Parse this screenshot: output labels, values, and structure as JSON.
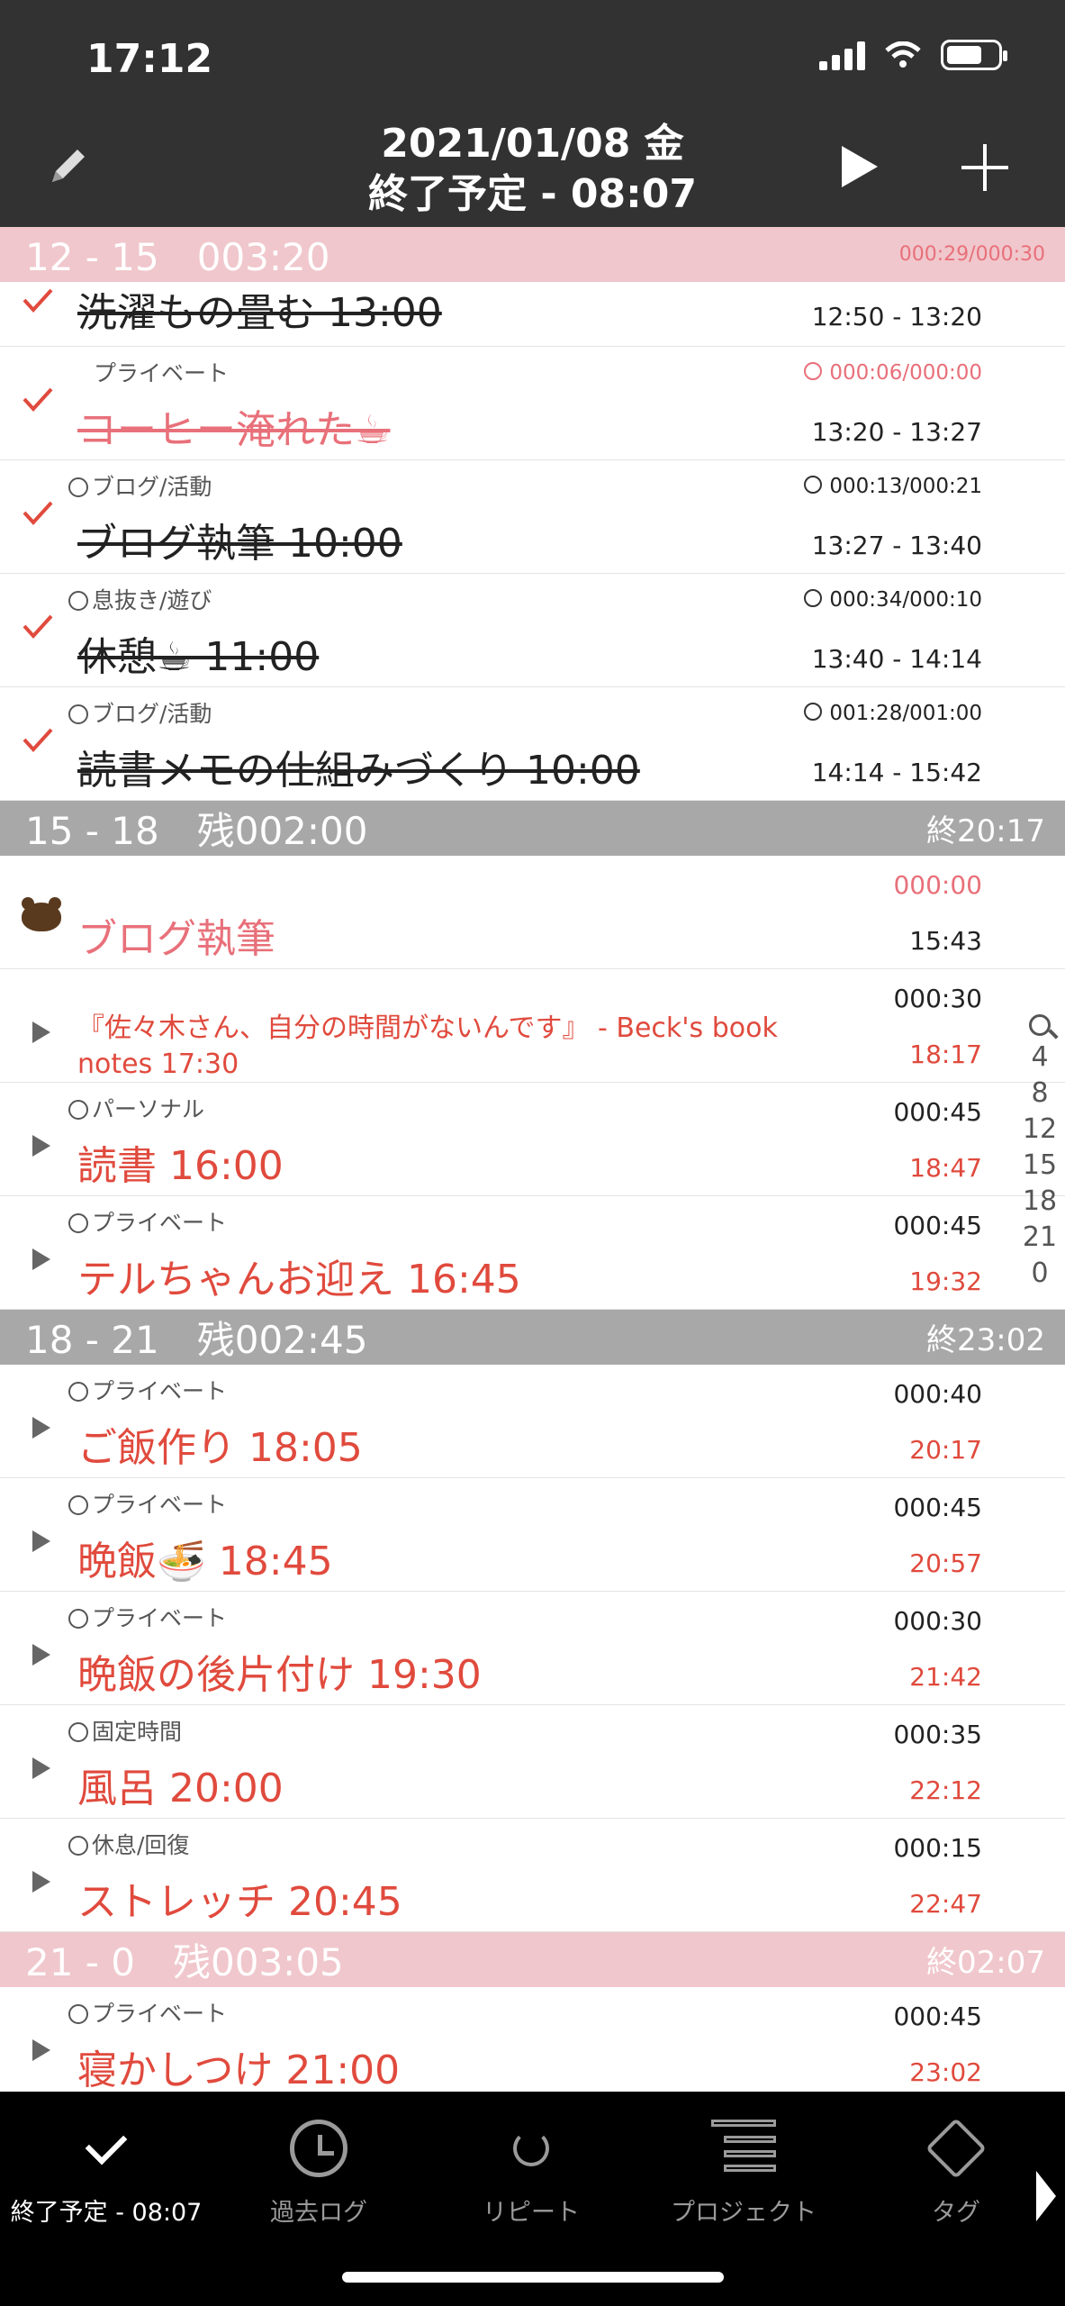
{
  "status_bar": {
    "time": "17:12"
  },
  "nav": {
    "date": "2021/01/08 金",
    "subtitle": "終了予定 - 08:07"
  },
  "sections": {
    "s12": {
      "label": "12 - 15　003:20",
      "right": "000:29/000:30"
    },
    "s15": {
      "label": "15 - 18　残002:00",
      "right": "終20:17"
    },
    "s18": {
      "label": "18 - 21　残002:45",
      "right": "終23:02"
    },
    "s21": {
      "label": "21 - 0　残003:05",
      "right": "終02:07"
    }
  },
  "tasks": [
    {
      "category": "",
      "title": "洗濯もの畳む 13:00",
      "duration": "",
      "time": "12:50 - 13:20"
    },
    {
      "category": "プライベート",
      "title": "コーヒー淹れた☕",
      "duration": "000:06/000:00",
      "time": "13:20 - 13:27"
    },
    {
      "category": "ブログ/活動",
      "title": "ブログ執筆 10:00",
      "duration": "000:13/000:21",
      "time": "13:27 - 13:40"
    },
    {
      "category": "息抜き/遊び",
      "title": "休憩☕ 11:00",
      "duration": "000:34/000:10",
      "time": "13:40 - 14:14"
    },
    {
      "category": "ブログ/活動",
      "title": "読書メモの仕組みづくり 10:00",
      "duration": "001:28/001:00",
      "time": "14:14 - 15:42"
    },
    {
      "category": "",
      "title": "ブログ執筆",
      "duration": "000:00",
      "time": "15:43"
    },
    {
      "category": "",
      "title": "『佐々木さん、自分の時間がないんです』 - Beck's book notes 17:30",
      "duration": "000:30",
      "time": "18:17"
    },
    {
      "category": "パーソナル",
      "title": "読書 16:00",
      "duration": "000:45",
      "time": "18:47"
    },
    {
      "category": "プライベート",
      "title": "テルちゃんお迎え 16:45",
      "duration": "000:45",
      "time": "19:32"
    },
    {
      "category": "プライベート",
      "title": "ご飯作り 18:05",
      "duration": "000:40",
      "time": "20:17"
    },
    {
      "category": "プライベート",
      "title": "晩飯🍜 18:45",
      "duration": "000:45",
      "time": "20:57"
    },
    {
      "category": "プライベート",
      "title": "晩飯の後片付け 19:30",
      "duration": "000:30",
      "time": "21:42"
    },
    {
      "category": "固定時間",
      "title": "風呂 20:00",
      "duration": "000:35",
      "time": "22:12"
    },
    {
      "category": "休息/回復",
      "title": "ストレッチ 20:45",
      "duration": "000:15",
      "time": "22:47"
    },
    {
      "category": "プライベート",
      "title": "寝かしつけ 21:00",
      "duration": "000:45",
      "time": "23:02"
    }
  ],
  "index_rail": [
    "4",
    "8",
    "12",
    "15",
    "18",
    "21",
    "0"
  ],
  "tabbar": [
    {
      "label": "終了予定 - 08:07",
      "icon": "check-icon"
    },
    {
      "label": "過去ログ",
      "icon": "clock-icon"
    },
    {
      "label": "リピート",
      "icon": "repeat-icon"
    },
    {
      "label": "プロジェクト",
      "icon": "project-icon"
    },
    {
      "label": "タグ",
      "icon": "tag-icon"
    }
  ]
}
